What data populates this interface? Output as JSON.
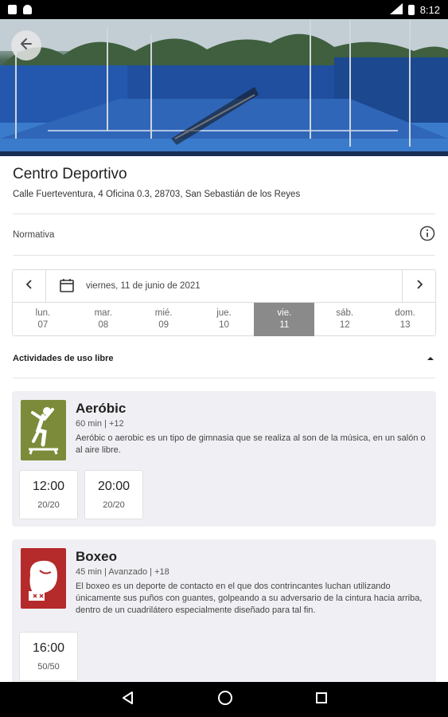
{
  "status_bar": {
    "time": "8:12",
    "network": "LTE"
  },
  "hero": {
    "back_label": "←"
  },
  "venue": {
    "title": "Centro Deportivo",
    "address": "Calle Fuerteventura, 4 Oficina 0.3, 28703, San Sebastián de los Reyes"
  },
  "rules": {
    "label": "Normativa"
  },
  "date_picker": {
    "current_date": "viernes, 11 de junio de 2021",
    "days": [
      {
        "name": "lun.",
        "num": "07"
      },
      {
        "name": "mar.",
        "num": "08"
      },
      {
        "name": "mié.",
        "num": "09"
      },
      {
        "name": "jue.",
        "num": "10"
      },
      {
        "name": "vie.",
        "num": "11"
      },
      {
        "name": "sáb.",
        "num": "12"
      },
      {
        "name": "dom.",
        "num": "13"
      }
    ],
    "selected_index": 4
  },
  "section": {
    "title": "Actividades de uso libre"
  },
  "activities": [
    {
      "name": "Aeróbic",
      "meta": "60 min  |  +12",
      "description": "Aeróbic o aerobic es un tipo de gimnasia que se realiza al son de la música, en un salón o al aire libre.",
      "icon_color": "#7b8b3a",
      "slots": [
        {
          "time": "12:00",
          "capacity": "20/20"
        },
        {
          "time": "20:00",
          "capacity": "20/20"
        }
      ]
    },
    {
      "name": "Boxeo",
      "meta": "45 min  |  Avanzado  |  +18",
      "description": "El boxeo es un deporte de contacto en el que dos contrincantes luchan utilizando únicamente sus puños con guantes, golpeando a su adversario de la cintura hacia arriba, dentro de un cuadrilátero especialmente diseñado para tal fin.",
      "icon_color": "#b52a2a",
      "slots": [
        {
          "time": "16:00",
          "capacity": "50/50"
        }
      ]
    }
  ]
}
